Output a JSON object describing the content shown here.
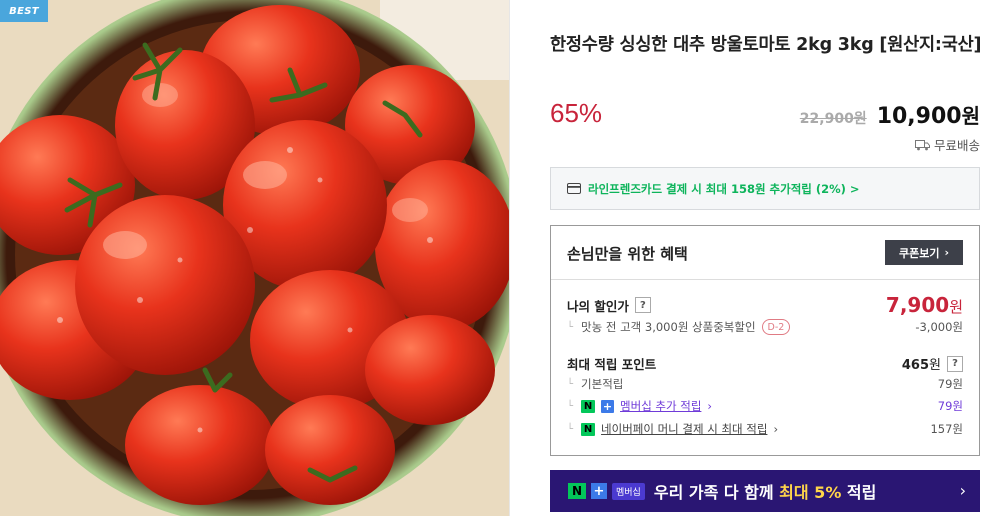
{
  "badge": "BEST",
  "product": {
    "title": "한정수량 싱싱한 대추 방울토마토 2kg 3kg [원산지:국산]",
    "discount_rate": "65%",
    "original_price": "22,900원",
    "sale_price": "10,900",
    "sale_price_unit": "원",
    "shipping": "무료배송"
  },
  "card_promo": "라인프렌즈카드 결제 시 최대 158원 추가적립 (2%) >",
  "benefit": {
    "title": "손님만을 위한 혜택",
    "coupon_button": "쿠폰보기",
    "my_price_label": "나의 할인가",
    "my_price": "7,900",
    "my_price_unit": "원",
    "discount_item_label": "맛농 전 고객 3,000원 상품중복할인",
    "discount_item_badge": "D-2",
    "discount_item_value": "-3,000원",
    "max_points_label": "최대 적립 포인트",
    "max_points": "465",
    "max_points_unit": "원",
    "basic_points_label": "기본적립",
    "basic_points_value": "79원",
    "membership_label": "멤버십 추가 적립",
    "membership_value": "79원",
    "npay_label": "네이버페이 머니 결제 시 최대 적립",
    "npay_value": "157원"
  },
  "banner": {
    "n_icon": "N",
    "plus_icon": "+",
    "tag": "멤버십",
    "text_before": "우리 가족 다 함께 ",
    "text_highlight": "최대 5%",
    "text_after": " 적립",
    "arrow": "›"
  },
  "icons": {
    "question": "?",
    "npay_n": "N",
    "plus": "+",
    "npay_pay": "N"
  },
  "colors": {
    "discount_red": "#c8243b",
    "card_green": "#0db45b",
    "membership_purple": "#6f3bd8",
    "banner_bg": "#2a1673",
    "badge_blue": "#4aa6dc"
  }
}
